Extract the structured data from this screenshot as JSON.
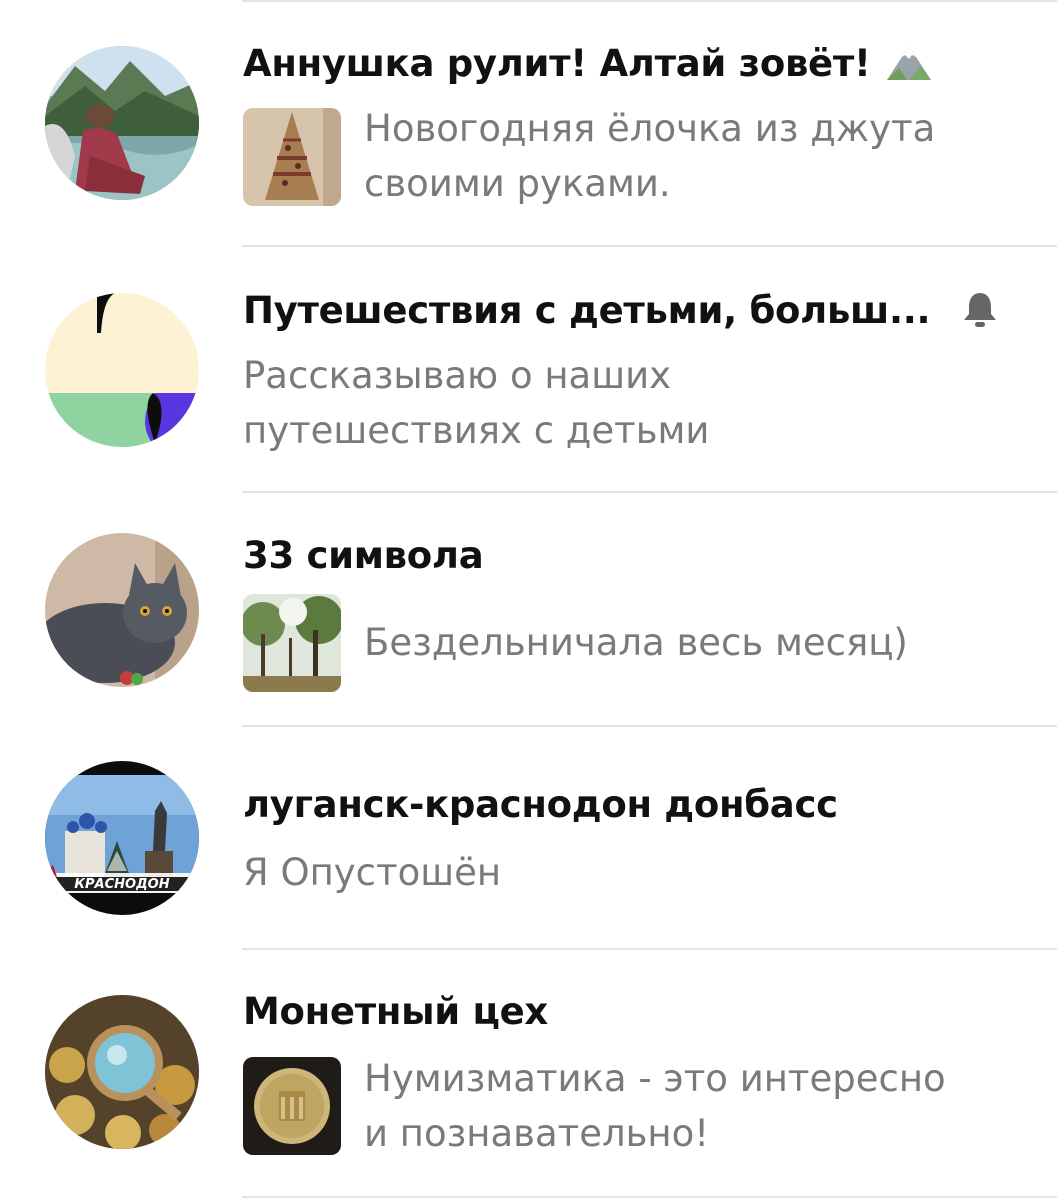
{
  "channels": [
    {
      "title": "Аннушка рулит! Алтай зовёт!",
      "title_emoji": "mountain-emoji",
      "desc_lines": [
        "Новогодняя ёлочка из джута",
        "своими руками."
      ],
      "has_thumb": true
    },
    {
      "title": "Путешествия с детьми, больш...",
      "desc_lines": [
        "Рассказываю о наших",
        "путешествиях с детьми"
      ],
      "has_thumb": false,
      "trailing_icon": "bell-icon"
    },
    {
      "title": "33 символа",
      "desc_lines": [
        "Бездельничала весь месяц)"
      ],
      "has_thumb": true
    },
    {
      "title": "луганск-краснодон донбасс",
      "desc_lines": [
        "Я Опустошён"
      ],
      "has_thumb": false,
      "avatar_text": "КРАСНОДОН"
    },
    {
      "title": "Монетный цех",
      "desc_lines": [
        "Нумизматика - это интересно",
        "и познавательно!"
      ],
      "has_thumb": true
    }
  ],
  "colors": {
    "title": "#111111",
    "description": "#7a7a7a",
    "divider": "#e4e4e4",
    "bell": "#666666"
  }
}
